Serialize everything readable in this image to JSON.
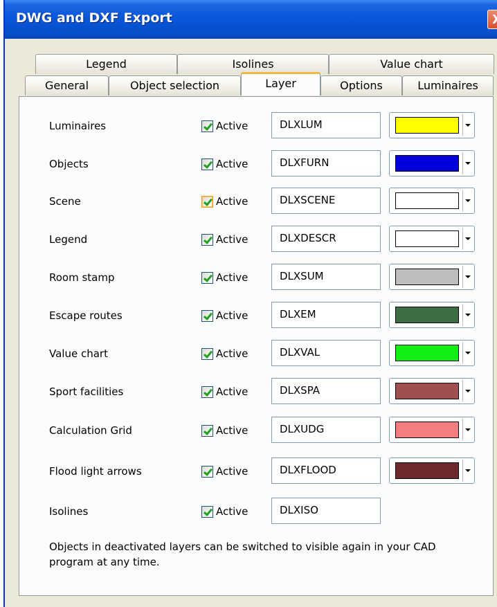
{
  "window": {
    "title": "DWG and DXF Export",
    "close_label": "X"
  },
  "tabs_back": [
    {
      "label": "Legend"
    },
    {
      "label": "Isolines"
    },
    {
      "label": "Value chart"
    }
  ],
  "tabs_front": [
    {
      "label": "General"
    },
    {
      "label": "Object selection"
    },
    {
      "label": "Layer",
      "active": true
    },
    {
      "label": "Options"
    },
    {
      "label": "Luminaires"
    }
  ],
  "active_label": "Active",
  "rows": [
    {
      "label": "Luminaires",
      "layer": "DLXLUM",
      "color": "#ffff00",
      "checked": true
    },
    {
      "label": "Objects",
      "layer": "DLXFURN",
      "color": "#0000dd",
      "checked": true
    },
    {
      "label": "Scene",
      "layer": "DLXSCENE",
      "color": "#ffffff",
      "checked": true
    },
    {
      "label": "Legend",
      "layer": "DLXDESCR",
      "color": "#ffffff",
      "checked": true
    },
    {
      "label": "Room stamp",
      "layer": "DLXSUM",
      "color": "#bdbdbd",
      "checked": true
    },
    {
      "label": "Escape routes",
      "layer": "DLXEM",
      "color": "#3b6e42",
      "checked": true
    },
    {
      "label": "Value chart",
      "layer": "DLXVAL",
      "color": "#11ee11",
      "checked": true
    },
    {
      "label": "Sport facilities",
      "layer": "DLXSPA",
      "color": "#a04f50",
      "checked": true
    },
    {
      "label": "Calculation Grid",
      "layer": "DLXUDG",
      "color": "#f47d7d",
      "checked": true
    },
    {
      "label": "Flood light arrows",
      "layer": "DLXFLOOD",
      "color": "#6c2a2d",
      "checked": true
    },
    {
      "label": "Isolines",
      "layer": "DLXISO",
      "color": null,
      "checked": true
    }
  ],
  "note": "Objects in deactivated layers can be switched to visible again in your CAD program at any time."
}
